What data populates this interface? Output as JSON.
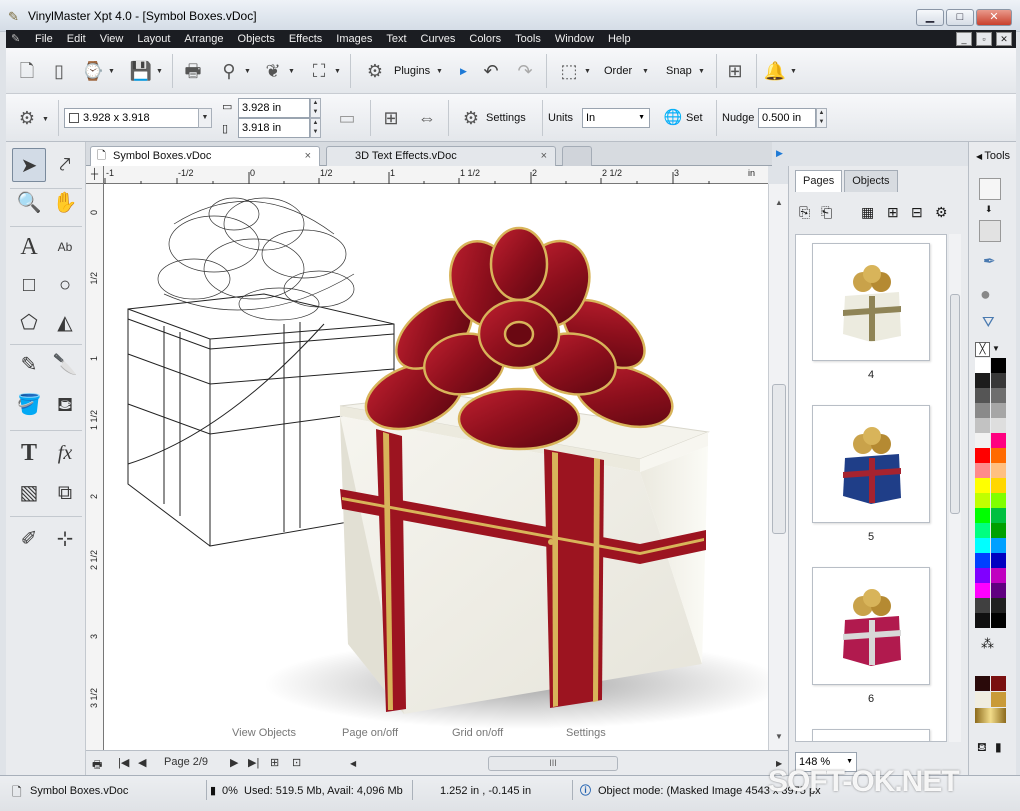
{
  "window": {
    "title": "VinylMaster Xpt 4.0 - [Symbol Boxes.vDoc]",
    "min_glyph": "▁",
    "max_glyph": "□",
    "close_glyph": "✕"
  },
  "menu": {
    "items": [
      "File",
      "Edit",
      "View",
      "Layout",
      "Arrange",
      "Objects",
      "Effects",
      "Images",
      "Text",
      "Curves",
      "Colors",
      "Tools",
      "Window",
      "Help"
    ]
  },
  "toolbar1": {
    "plugins_label": "Plugins",
    "order_label": "Order",
    "snap_label": "Snap"
  },
  "toolbar2": {
    "size_field": "3.928 x 3.918",
    "width_field": "3.928 in",
    "height_field": "3.918 in",
    "settings_label": "Settings",
    "units_label": "Units",
    "units_value": "In",
    "set_label": "Set",
    "nudge_label": "Nudge",
    "nudge_value": "0.500 in"
  },
  "tabs": [
    {
      "label": "Symbol Boxes.vDoc",
      "close": "×"
    },
    {
      "label": "3D Text Effects.vDoc",
      "close": "×"
    }
  ],
  "ruler_h": [
    "-1",
    "-1/2",
    "0",
    "1/2",
    "1",
    "1 1/2",
    "2",
    "2 1/2",
    "3",
    "in"
  ],
  "ruler_v": [
    "0",
    "1/2",
    "1",
    "1 1/2",
    "2",
    "2 1/2",
    "3",
    "3 1/2"
  ],
  "canvas_overlay": {
    "view_objects": "View Objects",
    "page_onoff": "Page on/off",
    "grid_onoff": "Grid on/off",
    "settings": "Settings"
  },
  "pager": {
    "page_label": "Page 2/9",
    "scroll_grip": "III"
  },
  "pages_panel": {
    "tab_pages": "Pages",
    "tab_objects": "Objects",
    "zoom": "148 %",
    "thumbnails": [
      {
        "number": "4",
        "box": "#ecebdf",
        "ribbon": "#8f8456"
      },
      {
        "number": "5",
        "box": "#1f3e88",
        "ribbon": "#a6232f"
      },
      {
        "number": "6",
        "box": "#b11a4e",
        "ribbon": "#d8d8d8"
      }
    ]
  },
  "tools_panel": {
    "label": "Tools"
  },
  "palette": [
    "#ffffff",
    "#000000",
    "#1c1c1c",
    "#383838",
    "#555555",
    "#6e6e6e",
    "#8a8a8a",
    "#a6a6a6",
    "#c2c2c2",
    "#dedede",
    "#f2f2f2",
    "#ff0080",
    "#ff0000",
    "#ff6a00",
    "#ff8a8a",
    "#ffc080",
    "#ffff00",
    "#ffd700",
    "#c0ff00",
    "#80ff00",
    "#00ff00",
    "#00c040",
    "#00ff80",
    "#00a000",
    "#00ffff",
    "#00a0ff",
    "#0040ff",
    "#0000c0",
    "#8000ff",
    "#c000c0",
    "#ff00ff",
    "#600080",
    "#404040",
    "#202020",
    "#101010",
    "#000000"
  ],
  "status": {
    "document": "Symbol Boxes.vDoc",
    "percent": "0%",
    "memory": "Used: 519.5 Mb, Avail: 4,096 Mb",
    "coords": "1.252 in , -0.145 in",
    "mode": "Object mode: (Masked Image 4543 x 3975 px"
  },
  "watermark": "SOFT-OK.NET",
  "colors": {
    "ribbon_red": "#9c1420",
    "gold": "#d8b45a",
    "box_white": "#f2f1ea",
    "accent_blue": "#1e7ad6"
  }
}
